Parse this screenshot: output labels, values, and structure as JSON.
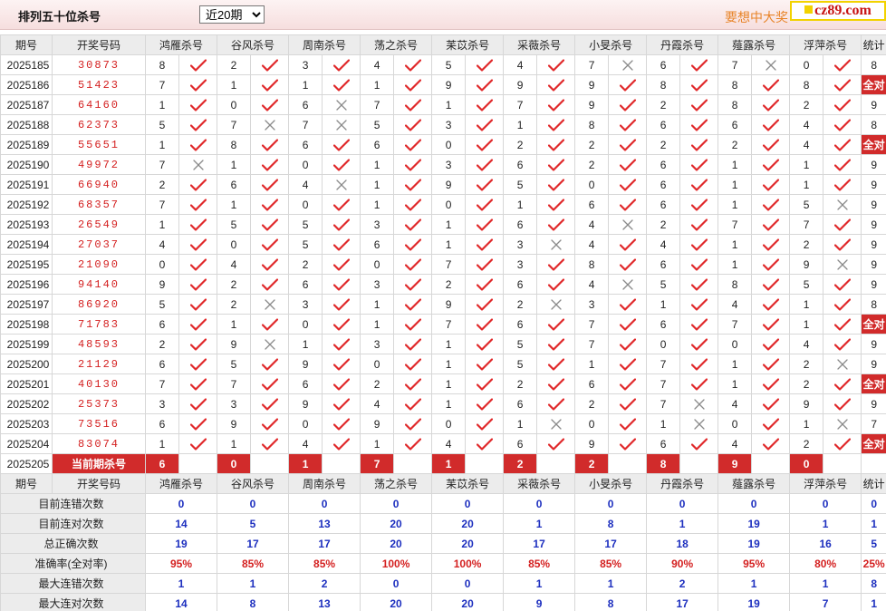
{
  "header": {
    "title": "排列五十位杀号",
    "period_select": {
      "selected": "近20期",
      "options": [
        "近20期"
      ]
    },
    "slogan": "要想中大奖",
    "brand": "cz89.com"
  },
  "columns": {
    "issue": "期号",
    "numbers": "开奖号码",
    "experts": [
      "鸿雁杀号",
      "谷风杀号",
      "周南杀号",
      "荡之杀号",
      "苿苡杀号",
      "采薇杀号",
      "小旻杀号",
      "丹霞杀号",
      "薤露杀号",
      "浮萍杀号"
    ],
    "stat": "统计"
  },
  "rows": [
    {
      "issue": "2025185",
      "numbers": "30873",
      "kill": [
        8,
        2,
        3,
        4,
        5,
        4,
        7,
        6,
        7,
        0
      ],
      "ok": [
        1,
        1,
        1,
        1,
        1,
        1,
        0,
        1,
        0,
        1
      ],
      "stat": "8"
    },
    {
      "issue": "2025186",
      "numbers": "51423",
      "kill": [
        7,
        1,
        1,
        1,
        9,
        9,
        9,
        8,
        8,
        8
      ],
      "ok": [
        1,
        1,
        1,
        1,
        1,
        1,
        1,
        1,
        1,
        1
      ],
      "stat": "全对"
    },
    {
      "issue": "2025187",
      "numbers": "64160",
      "kill": [
        1,
        0,
        6,
        7,
        1,
        7,
        9,
        2,
        8,
        2
      ],
      "ok": [
        1,
        1,
        0,
        1,
        1,
        1,
        1,
        1,
        1,
        1
      ],
      "stat": "9"
    },
    {
      "issue": "2025188",
      "numbers": "62373",
      "kill": [
        5,
        7,
        7,
        5,
        3,
        1,
        8,
        6,
        6,
        4
      ],
      "ok": [
        1,
        0,
        0,
        1,
        1,
        1,
        1,
        1,
        1,
        1
      ],
      "stat": "8"
    },
    {
      "issue": "2025189",
      "numbers": "55651",
      "kill": [
        1,
        8,
        6,
        6,
        0,
        2,
        2,
        2,
        2,
        4
      ],
      "ok": [
        1,
        1,
        1,
        1,
        1,
        1,
        1,
        1,
        1,
        1
      ],
      "stat": "全对"
    },
    {
      "issue": "2025190",
      "numbers": "49972",
      "kill": [
        7,
        1,
        0,
        1,
        3,
        6,
        2,
        6,
        1,
        1
      ],
      "ok": [
        0,
        1,
        1,
        1,
        1,
        1,
        1,
        1,
        1,
        1
      ],
      "stat": "9"
    },
    {
      "issue": "2025191",
      "numbers": "66940",
      "kill": [
        2,
        6,
        4,
        1,
        9,
        5,
        0,
        6,
        1,
        1
      ],
      "ok": [
        1,
        1,
        0,
        1,
        1,
        1,
        1,
        1,
        1,
        1
      ],
      "stat": "9"
    },
    {
      "issue": "2025192",
      "numbers": "68357",
      "kill": [
        7,
        1,
        0,
        1,
        0,
        1,
        6,
        6,
        1,
        5
      ],
      "ok": [
        1,
        1,
        1,
        1,
        1,
        1,
        1,
        1,
        1,
        0
      ],
      "stat": "9"
    },
    {
      "issue": "2025193",
      "numbers": "26549",
      "kill": [
        1,
        5,
        5,
        3,
        1,
        6,
        4,
        2,
        7,
        7
      ],
      "ok": [
        1,
        1,
        1,
        1,
        1,
        1,
        0,
        1,
        1,
        1
      ],
      "stat": "9"
    },
    {
      "issue": "2025194",
      "numbers": "27037",
      "kill": [
        4,
        0,
        5,
        6,
        1,
        3,
        4,
        4,
        1,
        2
      ],
      "ok": [
        1,
        1,
        1,
        1,
        1,
        0,
        1,
        1,
        1,
        1
      ],
      "stat": "9"
    },
    {
      "issue": "2025195",
      "numbers": "21090",
      "kill": [
        0,
        4,
        2,
        0,
        7,
        3,
        8,
        6,
        1,
        9
      ],
      "ok": [
        1,
        1,
        1,
        1,
        1,
        1,
        1,
        1,
        1,
        0
      ],
      "stat": "9"
    },
    {
      "issue": "2025196",
      "numbers": "94140",
      "kill": [
        9,
        2,
        6,
        3,
        2,
        6,
        4,
        5,
        8,
        5
      ],
      "ok": [
        1,
        1,
        1,
        1,
        1,
        1,
        0,
        1,
        1,
        1
      ],
      "stat": "9"
    },
    {
      "issue": "2025197",
      "numbers": "86920",
      "kill": [
        5,
        2,
        3,
        1,
        9,
        2,
        3,
        1,
        4,
        1
      ],
      "ok": [
        1,
        0,
        1,
        1,
        1,
        0,
        1,
        1,
        1,
        1
      ],
      "stat": "8"
    },
    {
      "issue": "2025198",
      "numbers": "71783",
      "kill": [
        6,
        1,
        0,
        1,
        7,
        6,
        7,
        6,
        7,
        1
      ],
      "ok": [
        1,
        1,
        1,
        1,
        1,
        1,
        1,
        1,
        1,
        1
      ],
      "stat": "全对"
    },
    {
      "issue": "2025199",
      "numbers": "48593",
      "kill": [
        2,
        9,
        1,
        3,
        1,
        5,
        7,
        0,
        0,
        4
      ],
      "ok": [
        1,
        0,
        1,
        1,
        1,
        1,
        1,
        1,
        1,
        1
      ],
      "stat": "9"
    },
    {
      "issue": "2025200",
      "numbers": "21129",
      "kill": [
        6,
        5,
        9,
        0,
        1,
        5,
        1,
        7,
        1,
        2
      ],
      "ok": [
        1,
        1,
        1,
        1,
        1,
        1,
        1,
        1,
        1,
        0
      ],
      "stat": "9"
    },
    {
      "issue": "2025201",
      "numbers": "40130",
      "kill": [
        7,
        7,
        6,
        2,
        1,
        2,
        6,
        7,
        1,
        2
      ],
      "ok": [
        1,
        1,
        1,
        1,
        1,
        1,
        1,
        1,
        1,
        1
      ],
      "stat": "全对"
    },
    {
      "issue": "2025202",
      "numbers": "25373",
      "kill": [
        3,
        3,
        9,
        4,
        1,
        6,
        2,
        7,
        4,
        9
      ],
      "ok": [
        1,
        1,
        1,
        1,
        1,
        1,
        1,
        0,
        1,
        1
      ],
      "stat": "9"
    },
    {
      "issue": "2025203",
      "numbers": "73516",
      "kill": [
        6,
        9,
        0,
        9,
        0,
        1,
        0,
        1,
        0,
        1
      ],
      "ok": [
        1,
        1,
        1,
        1,
        1,
        0,
        1,
        0,
        1,
        0
      ],
      "stat": "7"
    },
    {
      "issue": "2025204",
      "numbers": "83074",
      "kill": [
        1,
        1,
        4,
        1,
        4,
        6,
        9,
        6,
        4,
        2
      ],
      "ok": [
        1,
        1,
        1,
        1,
        1,
        1,
        1,
        1,
        1,
        1
      ],
      "stat": "全对"
    }
  ],
  "current": {
    "issue": "2025205",
    "label": "当前期杀号",
    "kill": [
      6,
      0,
      1,
      7,
      1,
      2,
      2,
      8,
      9,
      0
    ]
  },
  "summary": [
    {
      "label": "目前连错次数",
      "values": [
        "0",
        "0",
        "0",
        "0",
        "0",
        "0",
        "0",
        "0",
        "0",
        "0"
      ],
      "stat": "0",
      "style": "val"
    },
    {
      "label": "目前连对次数",
      "values": [
        "14",
        "5",
        "13",
        "20",
        "20",
        "1",
        "8",
        "1",
        "19",
        "1"
      ],
      "stat": "1",
      "style": "val"
    },
    {
      "label": "总正确次数",
      "values": [
        "19",
        "17",
        "17",
        "20",
        "20",
        "17",
        "17",
        "18",
        "19",
        "16"
      ],
      "stat": "5",
      "style": "val"
    },
    {
      "label": "准确率(全对率)",
      "values": [
        "95%",
        "85%",
        "85%",
        "100%",
        "100%",
        "85%",
        "85%",
        "90%",
        "95%",
        "80%"
      ],
      "stat": "25%",
      "style": "pct"
    },
    {
      "label": "最大连错次数",
      "values": [
        "1",
        "1",
        "2",
        "0",
        "0",
        "1",
        "1",
        "2",
        "1",
        "1"
      ],
      "stat": "8",
      "style": "val"
    },
    {
      "label": "最大连对次数",
      "values": [
        "14",
        "8",
        "13",
        "20",
        "20",
        "9",
        "8",
        "17",
        "19",
        "7"
      ],
      "stat": "1",
      "style": "val"
    }
  ],
  "icons": {
    "correct": "check-icon",
    "wrong": "cross-icon"
  },
  "colors": {
    "accent": "#d12b2b",
    "number": "#d42020",
    "stat_blue": "#1d2fbf",
    "slogan": "#e8852a",
    "header_bg": "#ececec"
  }
}
